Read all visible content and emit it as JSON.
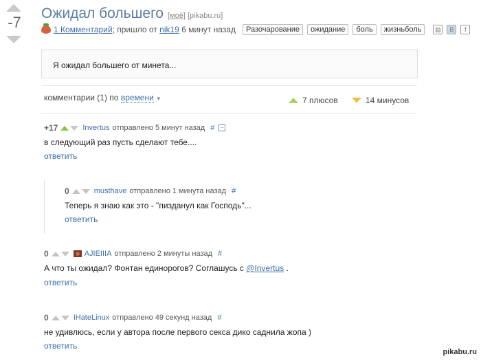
{
  "post": {
    "rating": "-7",
    "title": "Ожидал большего",
    "title_tag_mine": "[моё]",
    "title_source": "[pikabu.ru]",
    "comments_link": "1 Комментарий",
    "meta_text": "; пришло от",
    "author": "nik19",
    "time_ago": "6 минут назад",
    "tags": [
      "Разочарование",
      "ожидание",
      "боль",
      "жизньболь"
    ],
    "body": "Я ожидал большего от минета..."
  },
  "comments_header": {
    "label": "комментарии (1) по",
    "sort": "времени",
    "plus_count": "7 плюсов",
    "minus_count": "14 минусов"
  },
  "comments": [
    {
      "rating": "+17",
      "author": "Invertus",
      "posted": "отправлено 5 минут назад",
      "hash": "#",
      "text": "в следующий раз пусть сделают тебе....",
      "reply": "ответить"
    },
    {
      "rating": "0",
      "author": "musthave",
      "posted": "отправлено 1 минута назад",
      "hash": "#",
      "text": "Теперь я знаю как это - \"пизданул как Господь\"...",
      "reply": "ответить"
    },
    {
      "rating": "0",
      "author": "AJIEIIIA",
      "posted": "отправлено 2 минуты назад",
      "hash": "#",
      "text_before": "А что ты ожидал? Фонтан единорогов? Соглашусь с",
      "mention": "@Invertus",
      "text_after": ".",
      "reply": "ответить"
    },
    {
      "rating": "0",
      "author": "IHateLinux",
      "posted": "отправлено 49 секунд назад",
      "hash": "#",
      "text": "не удивлюсь, если у автора после первого секса дико саднила жопа )",
      "reply": "ответить"
    }
  ],
  "watermark": "pikabu.ru",
  "icons": [
    "save-icon",
    "vk-icon",
    "facebook-icon"
  ]
}
